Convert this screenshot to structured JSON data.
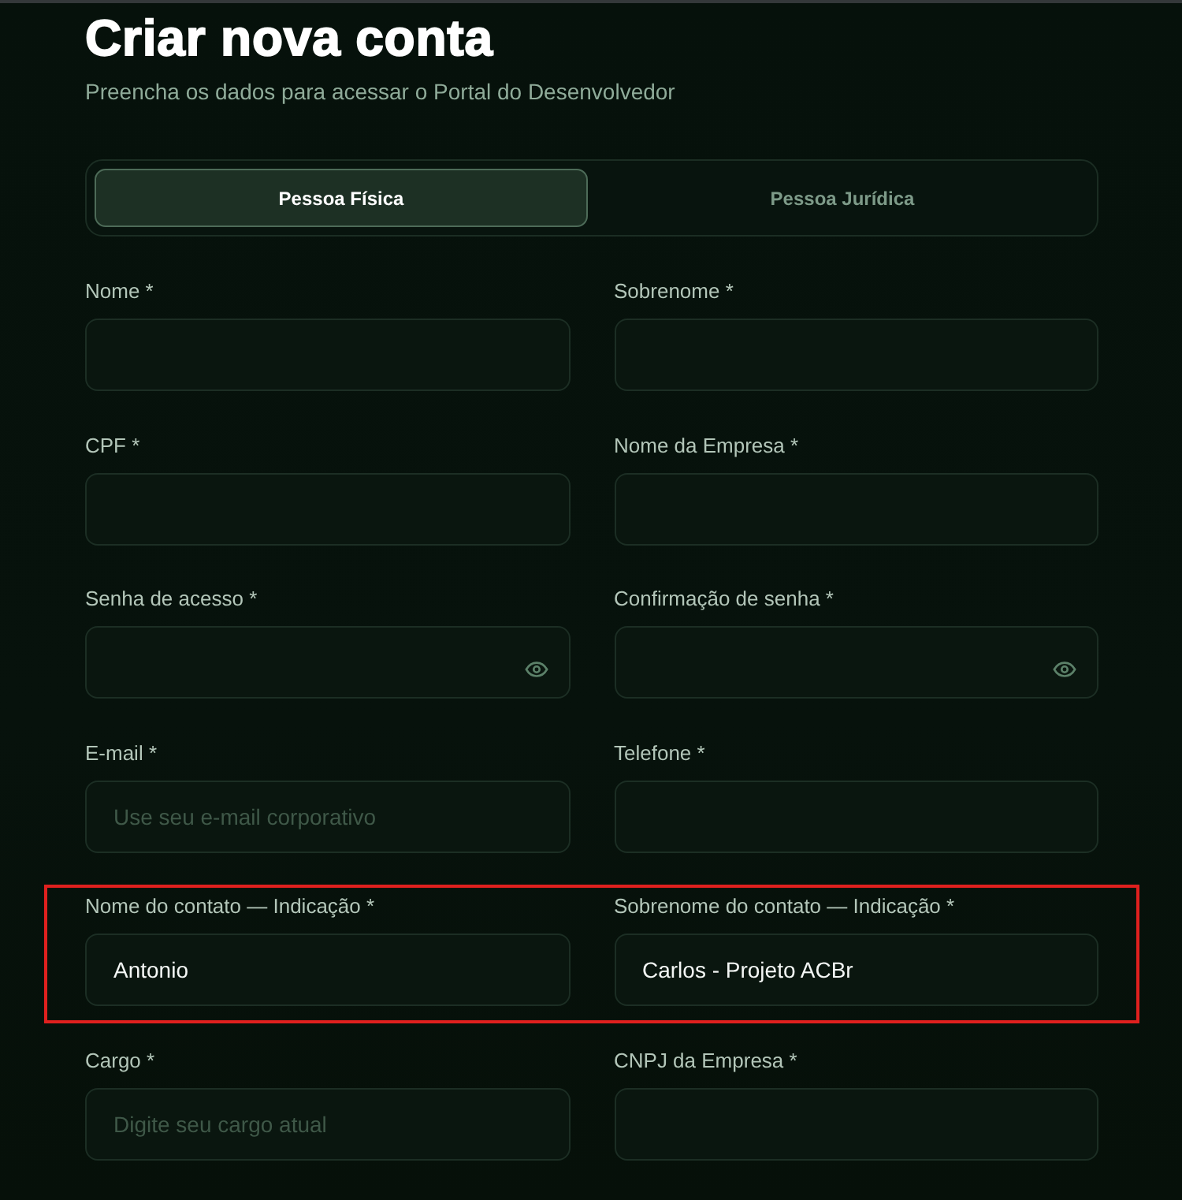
{
  "header": {
    "title": "Criar nova conta",
    "subtitle": "Preencha os dados para acessar o Portal do Desenvolvedor"
  },
  "account_type_tabs": [
    {
      "label": "Pessoa Física",
      "selected": true
    },
    {
      "label": "Pessoa Jurídica",
      "selected": false
    }
  ],
  "rows": [
    {
      "highlighted": false,
      "fields": [
        {
          "kind": "text",
          "label": "Nome *"
        },
        {
          "kind": "text",
          "label": "Sobrenome *"
        }
      ]
    },
    {
      "highlighted": false,
      "fields": [
        {
          "kind": "text",
          "label": "CPF *"
        },
        {
          "kind": "text",
          "label": "Nome da Empresa *"
        }
      ]
    },
    {
      "highlighted": false,
      "fields": [
        {
          "kind": "password",
          "label": "Senha de acesso *"
        },
        {
          "kind": "password",
          "label": "Confirmação de senha *"
        }
      ]
    },
    {
      "highlighted": false,
      "fields": [
        {
          "kind": "text",
          "label": "E-mail *",
          "placeholder": "Use seu e-mail corporativo"
        },
        {
          "kind": "text",
          "label": "Telefone *"
        }
      ]
    },
    {
      "highlighted": true,
      "fields": [
        {
          "kind": "text",
          "label": "Nome do contato — Indicação *",
          "value": "Antonio"
        },
        {
          "kind": "text",
          "label": "Sobrenome do contato — Indicação *",
          "value": "Carlos - Projeto ACBr"
        }
      ]
    },
    {
      "highlighted": false,
      "fields": [
        {
          "kind": "text",
          "label": "Cargo *",
          "placeholder": "Digite seu cargo atual"
        },
        {
          "kind": "text",
          "label": "CNPJ da Empresa *"
        }
      ]
    }
  ]
}
